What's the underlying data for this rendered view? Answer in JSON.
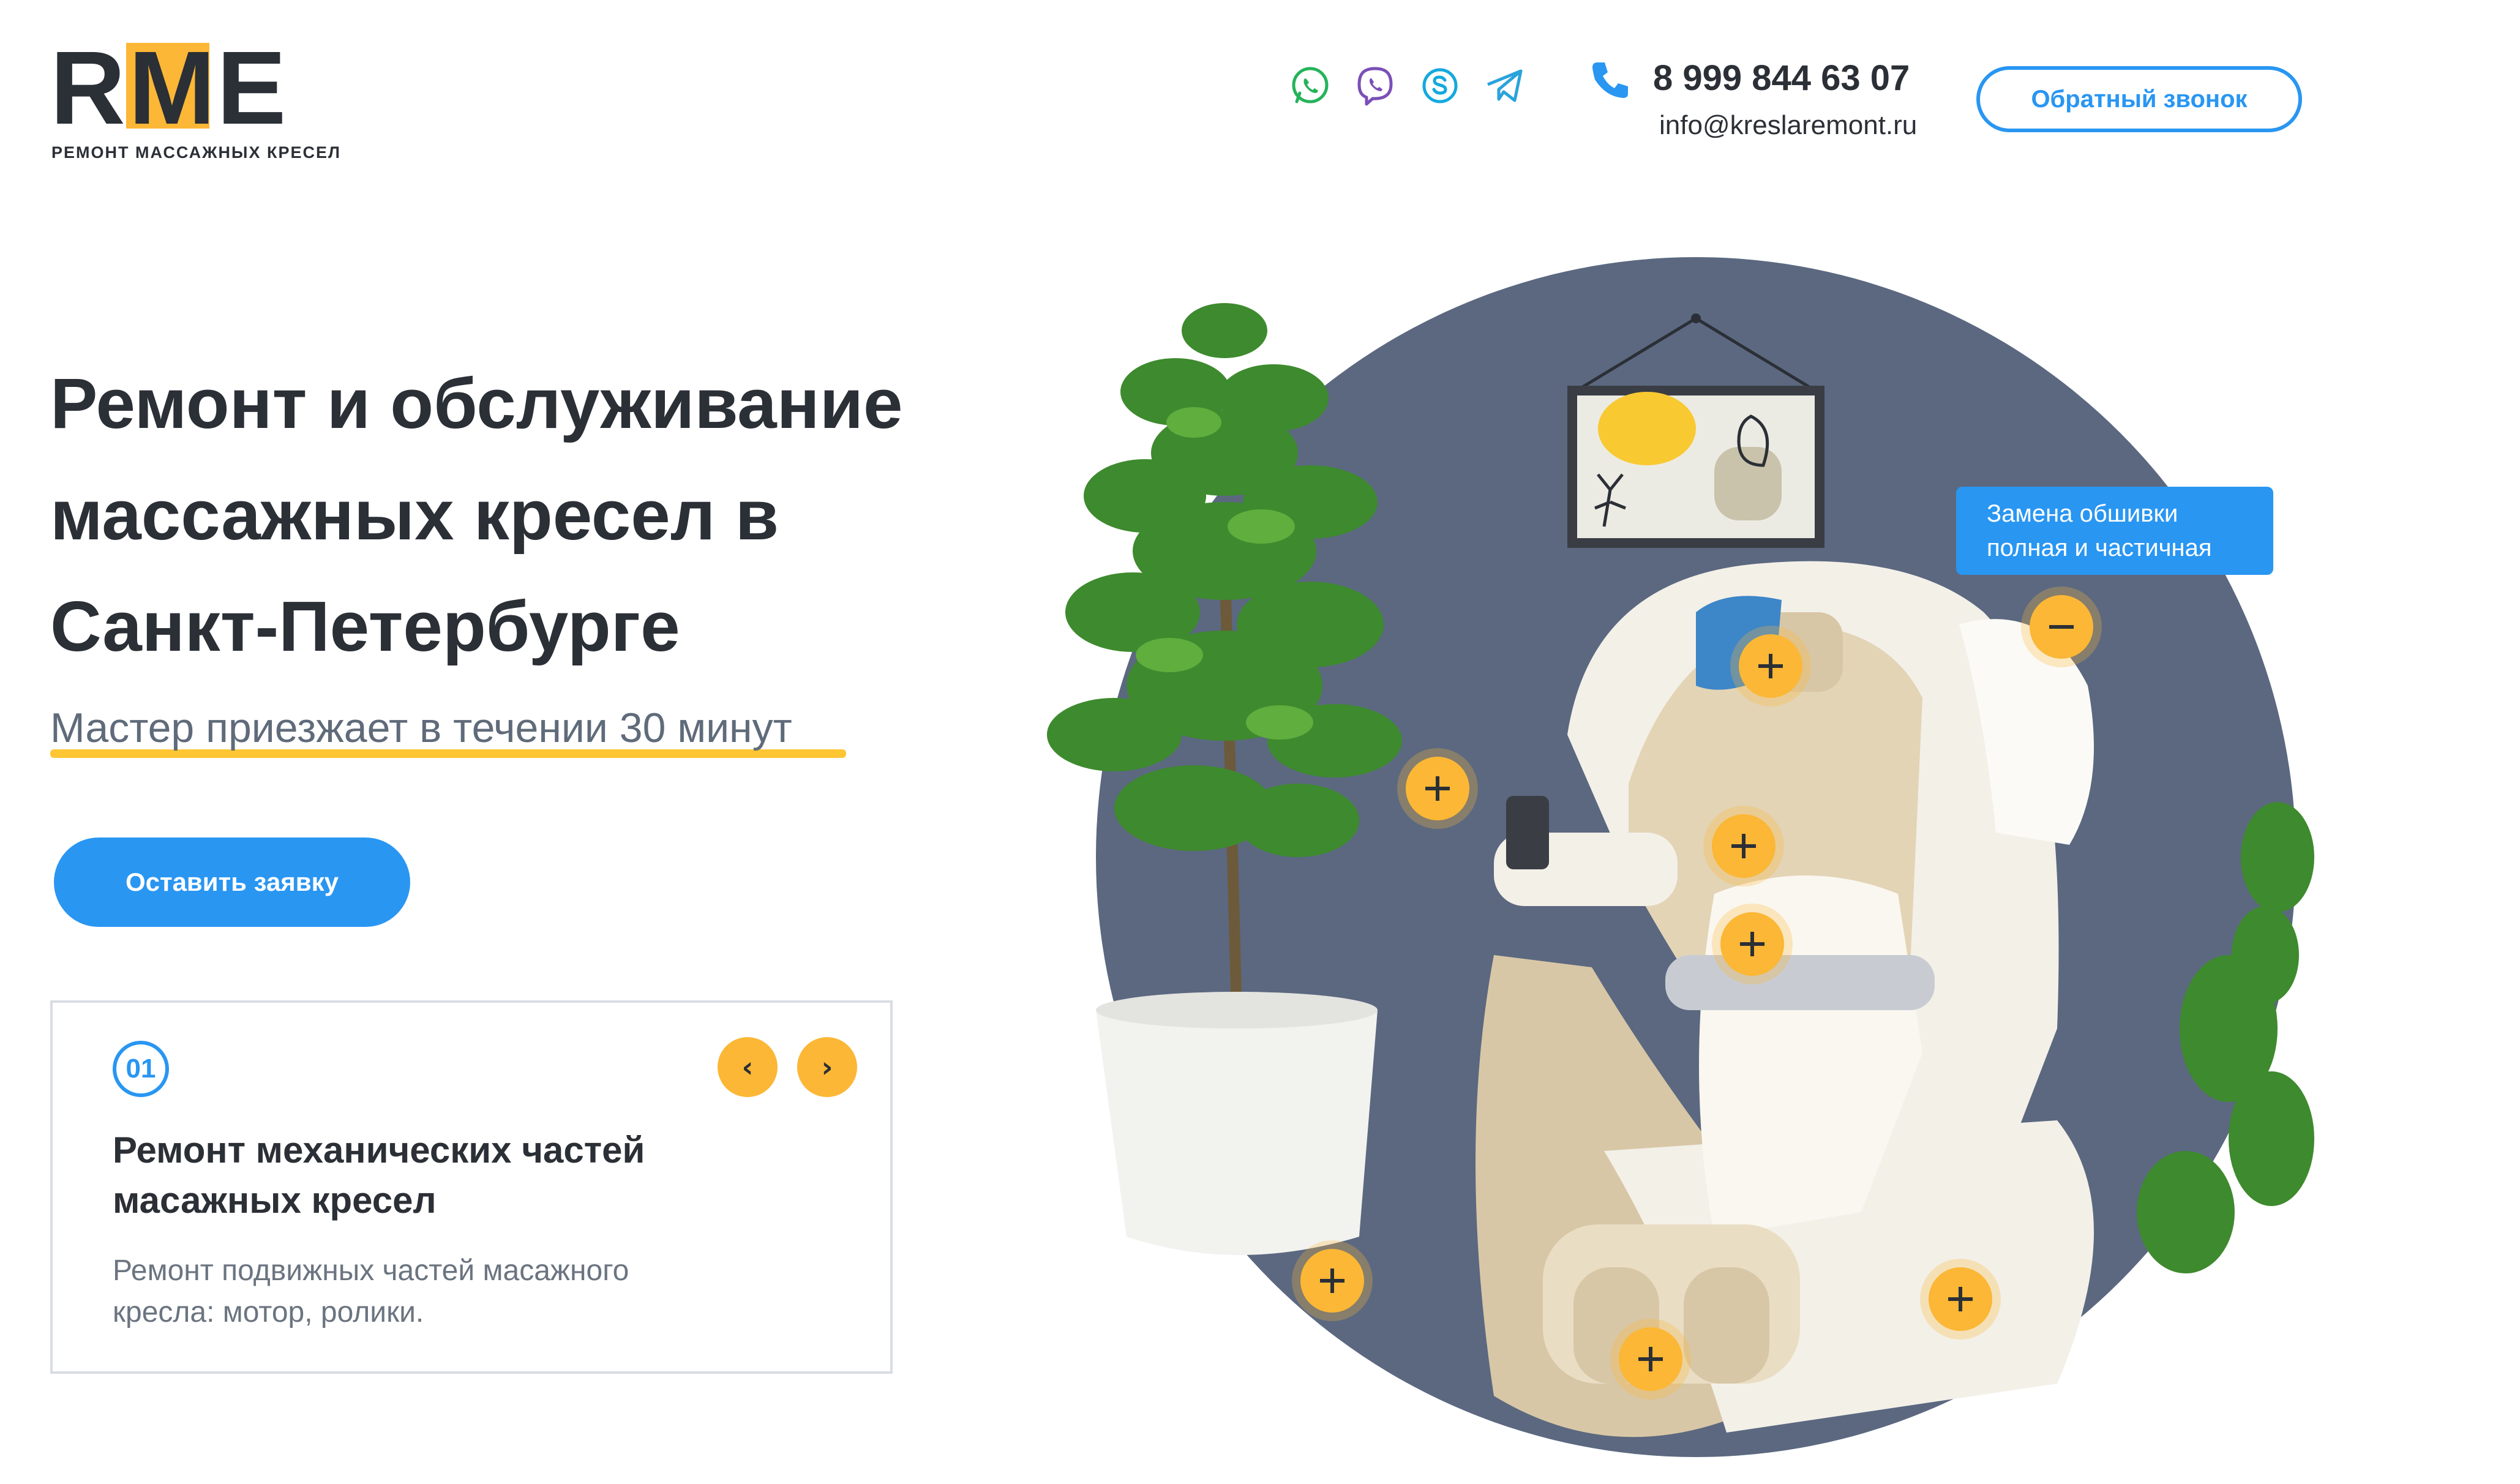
{
  "logo": {
    "letters": [
      "R",
      "M",
      "E"
    ],
    "tagline": "РЕМОНТ МАССАЖНЫХ КРЕСЕЛ",
    "accent_color": "#fbb735"
  },
  "header": {
    "messengers": [
      "whatsapp-icon",
      "viber-icon",
      "skype-icon",
      "telegram-icon"
    ],
    "phone": "8 999 844 63 07",
    "email": "info@kreslaremont.ru",
    "callback_label": "Обратный звонок"
  },
  "hero": {
    "title_lines": [
      "Ремонт и обслуживание",
      "массажных кресел в",
      "Санкт-Петербурге"
    ],
    "subtitle": "Мастер приезжает в течении 30 минут",
    "cta_label": "Оставить заявку"
  },
  "service_card": {
    "number": "01",
    "title_lines": [
      "Ремонт механических частей",
      "масажных кресел"
    ],
    "text_lines": [
      "Ремонт подвижных частей масажного",
      "кресла: мотор, ролики."
    ],
    "prev_icon": "‹",
    "next_icon": "›"
  },
  "illustration": {
    "tooltip_lines": [
      "Замена обшивки",
      "полная и частичная"
    ],
    "active_hotspot_symbol": "−",
    "hotspot_symbol": "+",
    "colors": {
      "primary": "#2996f2",
      "accent": "#fbb735",
      "circle_bg": "#5b6880",
      "text_dark": "#2b2f36"
    }
  }
}
